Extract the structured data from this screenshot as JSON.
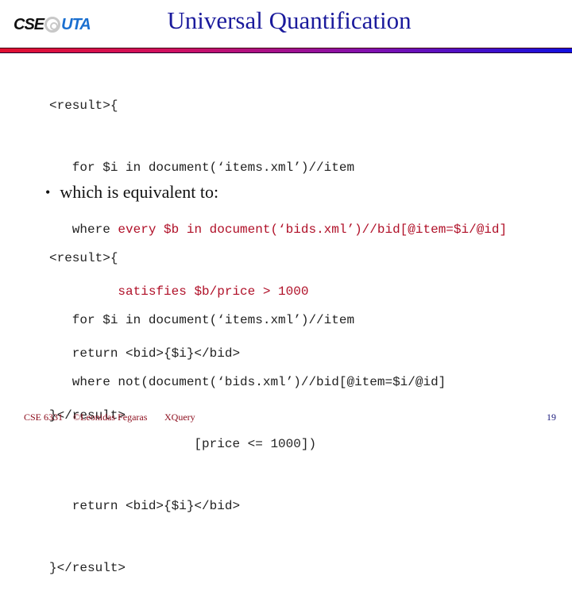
{
  "header": {
    "logo": {
      "left": "CSE",
      "right": "UTA",
      "icon": "at-sign-icon"
    },
    "title": "Universal Quantification"
  },
  "block1": {
    "lines": [
      {
        "pre": "<result>{",
        "hl": ""
      },
      {
        "pre": "   for $i in document(‘items.xml’)//item",
        "hl": ""
      },
      {
        "pre": "   where ",
        "hl": "every $b in document(‘bids.xml’)//bid[@item=$i/@id]"
      },
      {
        "pre": "         ",
        "hl": "satisfies $b/price > 1000"
      },
      {
        "pre": "   return <bid>{$i}</bid>",
        "hl": ""
      },
      {
        "pre": "}</result>",
        "hl": ""
      }
    ]
  },
  "bullet": {
    "text": "which is equivalent to:"
  },
  "block2": {
    "lines": [
      "<result>{",
      "   for $i in document(‘items.xml’)//item",
      "   where not(document(‘bids.xml’)//bid[@item=$i/@id]",
      "                   [price <= 1000])",
      "   return <bid>{$i}</bid>",
      "}</result>"
    ]
  },
  "footer": {
    "course": "CSE 6331",
    "author": "©Leonidas Fegaras",
    "topic": "XQuery",
    "page": "19"
  },
  "colors": {
    "title": "#1a1a9c",
    "highlight": "#b01028",
    "footer": "#8b0a1a",
    "page_number": "#1a1a7c"
  }
}
